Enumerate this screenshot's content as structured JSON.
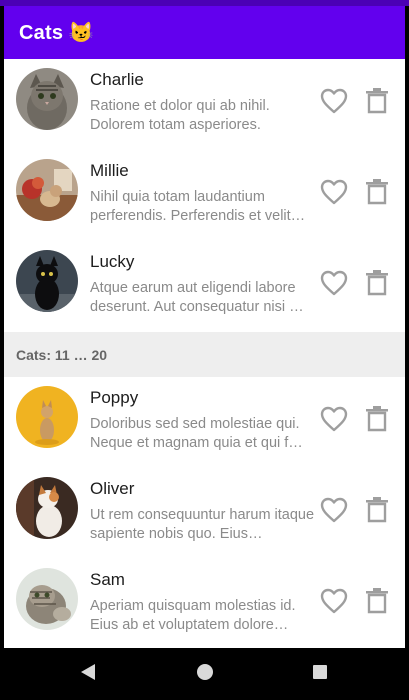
{
  "app": {
    "title": "Cats 😼"
  },
  "section_header": "Cats: 11 … 20",
  "cats_top": [
    {
      "name": "Charlie",
      "description": "Ratione et dolor qui ab nihil. Dolorem totam asperiores."
    },
    {
      "name": "Millie",
      "description": "Nihil quia totam laudantium perferendis. Perferendis et velit…"
    },
    {
      "name": "Lucky",
      "description": "Atque earum aut eligendi labore deserunt. Aut consequatur nisi …"
    }
  ],
  "cats_bottom": [
    {
      "name": "Poppy",
      "description": "Doloribus sed sed molestiae qui. Neque et magnam quia et qui f…"
    },
    {
      "name": "Oliver",
      "description": "Ut rem consequuntur harum itaque sapiente nobis quo. Eius…"
    },
    {
      "name": "Sam",
      "description": "Aperiam quisquam molestias id. Eius ab et voluptatem dolore…"
    }
  ],
  "icons": {
    "favorite": "heart-outline-icon",
    "delete": "trash-icon",
    "nav_back": "back-triangle-icon",
    "nav_home": "home-circle-icon",
    "nav_recents": "recents-square-icon"
  },
  "colors": {
    "app_bar": "#6200ee",
    "status_bar": "#4b00b5",
    "icon_gray": "#9e9e9e",
    "section_bg": "#eeeeee"
  }
}
